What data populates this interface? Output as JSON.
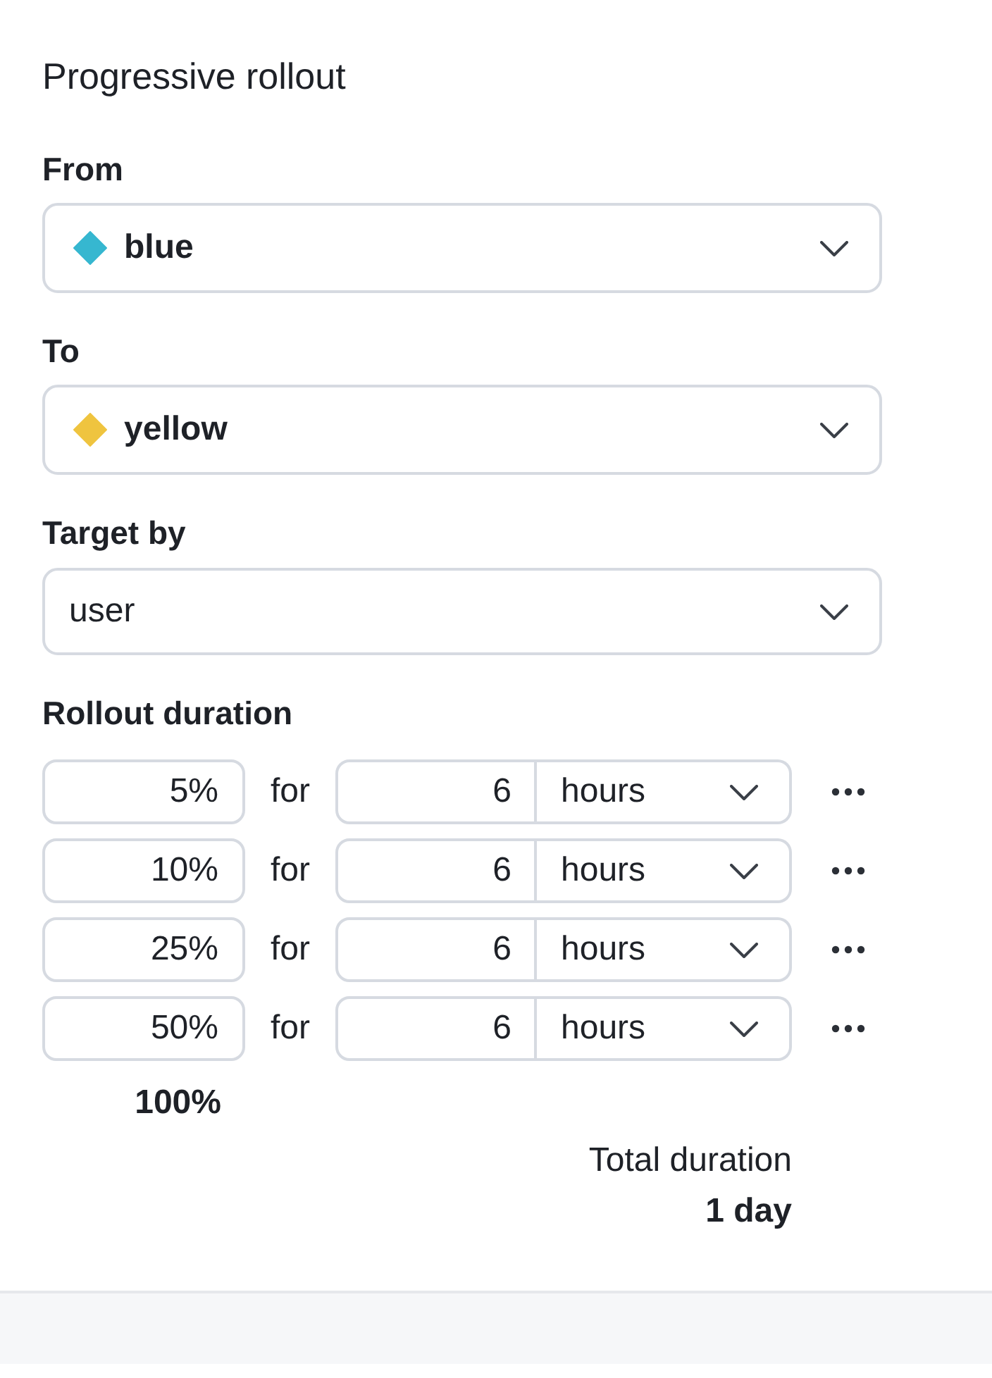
{
  "panel": {
    "title": "Progressive rollout"
  },
  "fields": [
    {
      "label": "From",
      "kind": "variant",
      "value": "blue",
      "color": "#36b7d0"
    },
    {
      "label": "To",
      "kind": "variant",
      "value": "yellow",
      "color": "#efc43f"
    },
    {
      "label": "Target by",
      "kind": "plain",
      "value": "user"
    }
  ],
  "rollout": {
    "label": "Rollout duration",
    "steps": [
      {
        "percent": "5%",
        "connector": "for",
        "amount": "6",
        "unit": "hours"
      },
      {
        "percent": "10%",
        "connector": "for",
        "amount": "6",
        "unit": "hours"
      },
      {
        "percent": "25%",
        "connector": "for",
        "amount": "6",
        "unit": "hours"
      },
      {
        "percent": "50%",
        "connector": "for",
        "amount": "6",
        "unit": "hours"
      }
    ],
    "final_percent": "100%",
    "total": {
      "label": "Total duration",
      "value": "1 day"
    }
  }
}
